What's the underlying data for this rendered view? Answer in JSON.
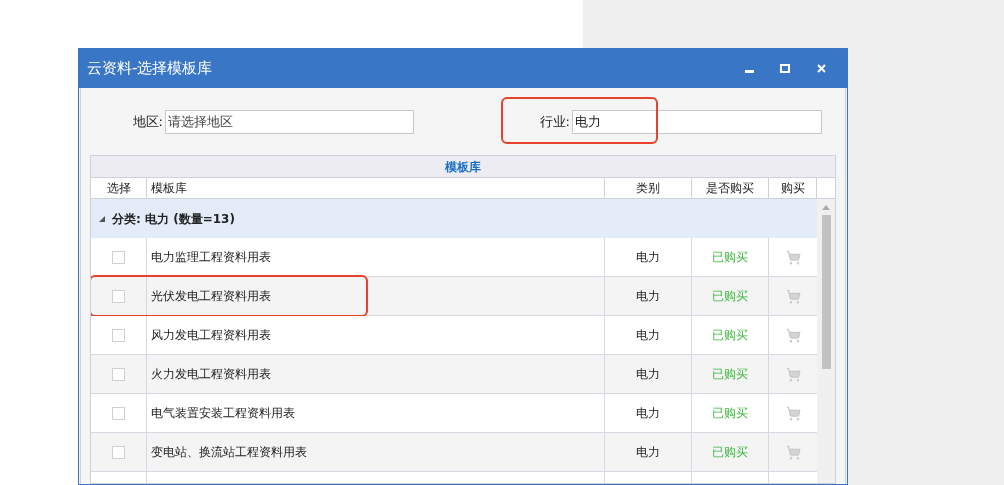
{
  "window": {
    "title": "云资料-选择模板库"
  },
  "filters": [
    {
      "label": "地区:",
      "placeholder": "请选择地区",
      "highlighted": false
    },
    {
      "label": "行业:",
      "value": "电力",
      "highlighted": true
    }
  ],
  "table": {
    "title": "模板库",
    "columns": [
      "选择",
      "模板库",
      "类别",
      "是否购买",
      "购买"
    ],
    "group": {
      "label": "分类: 电力 (数量=13)",
      "expanded": true
    },
    "rows": [
      {
        "checked": false,
        "name": "电力监理工程资料用表",
        "category": "电力",
        "status": "已购买",
        "highlighted": false
      },
      {
        "checked": false,
        "name": "光伏发电工程资料用表",
        "category": "电力",
        "status": "已购买",
        "highlighted": true
      },
      {
        "checked": false,
        "name": "风力发电工程资料用表",
        "category": "电力",
        "status": "已购买",
        "highlighted": false
      },
      {
        "checked": false,
        "name": "火力发电工程资料用表",
        "category": "电力",
        "status": "已购买",
        "highlighted": false
      },
      {
        "checked": false,
        "name": "电气装置安装工程资料用表",
        "category": "电力",
        "status": "已购买",
        "highlighted": false
      },
      {
        "checked": false,
        "name": "变电站、换流站工程资料用表",
        "category": "电力",
        "status": "已购买",
        "highlighted": false
      }
    ]
  }
}
